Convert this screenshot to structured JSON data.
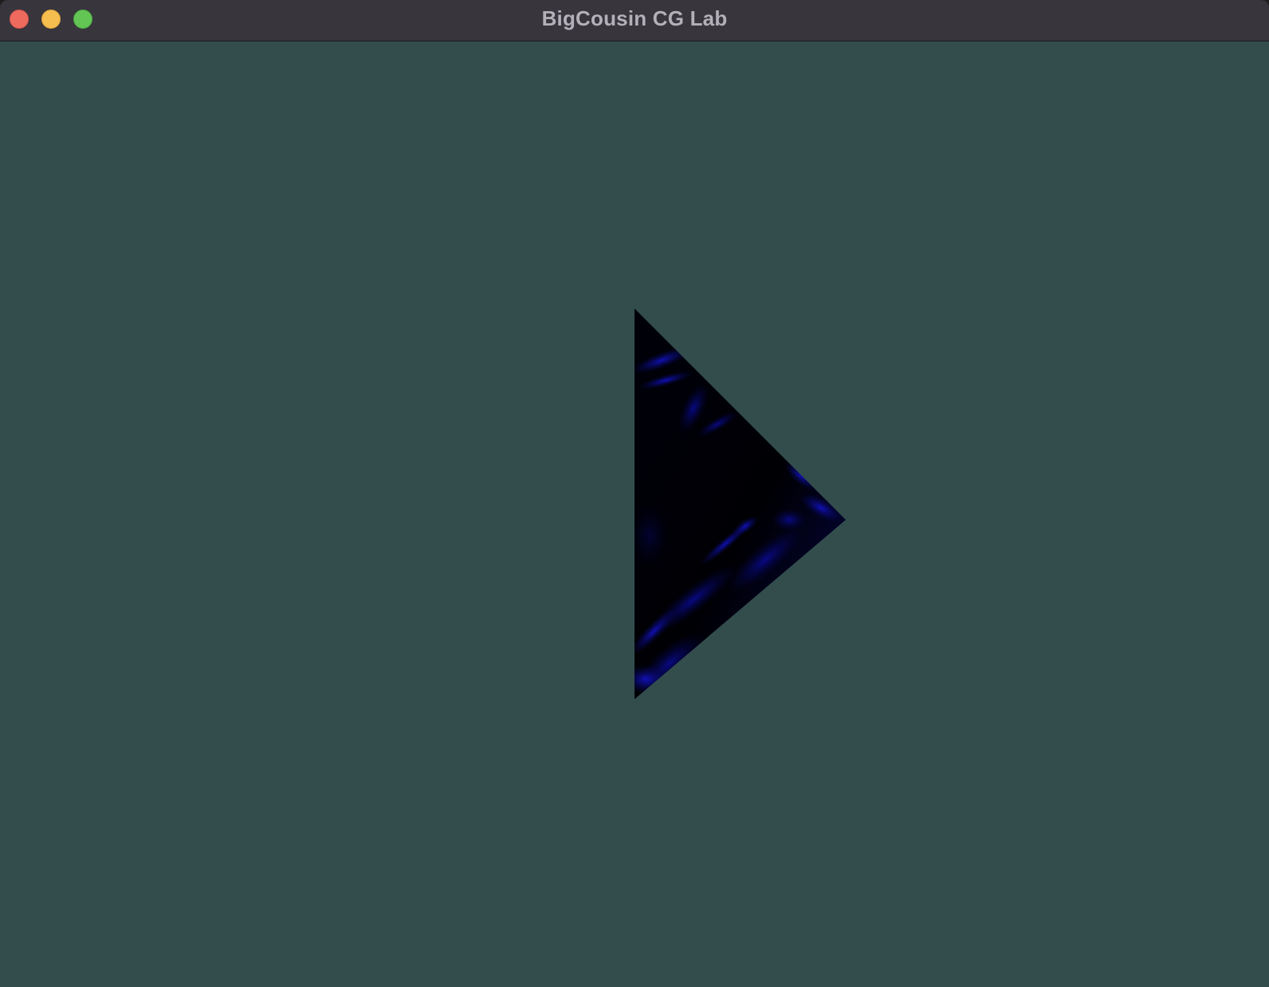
{
  "window": {
    "title": "BigCousin CG Lab",
    "controls": {
      "close_icon": "close-icon",
      "minimize_icon": "minimize-icon",
      "zoom_icon": "zoom-icon"
    }
  },
  "colors": {
    "titlebar": "#38353d",
    "title_text": "#b3b0b8",
    "clear_color": "#334d4d",
    "close": "#ee6a5f",
    "minimize": "#f5be4f",
    "zoom": "#62c554",
    "texture_dark": "#000008",
    "texture_blue": "#0a0a9a"
  }
}
